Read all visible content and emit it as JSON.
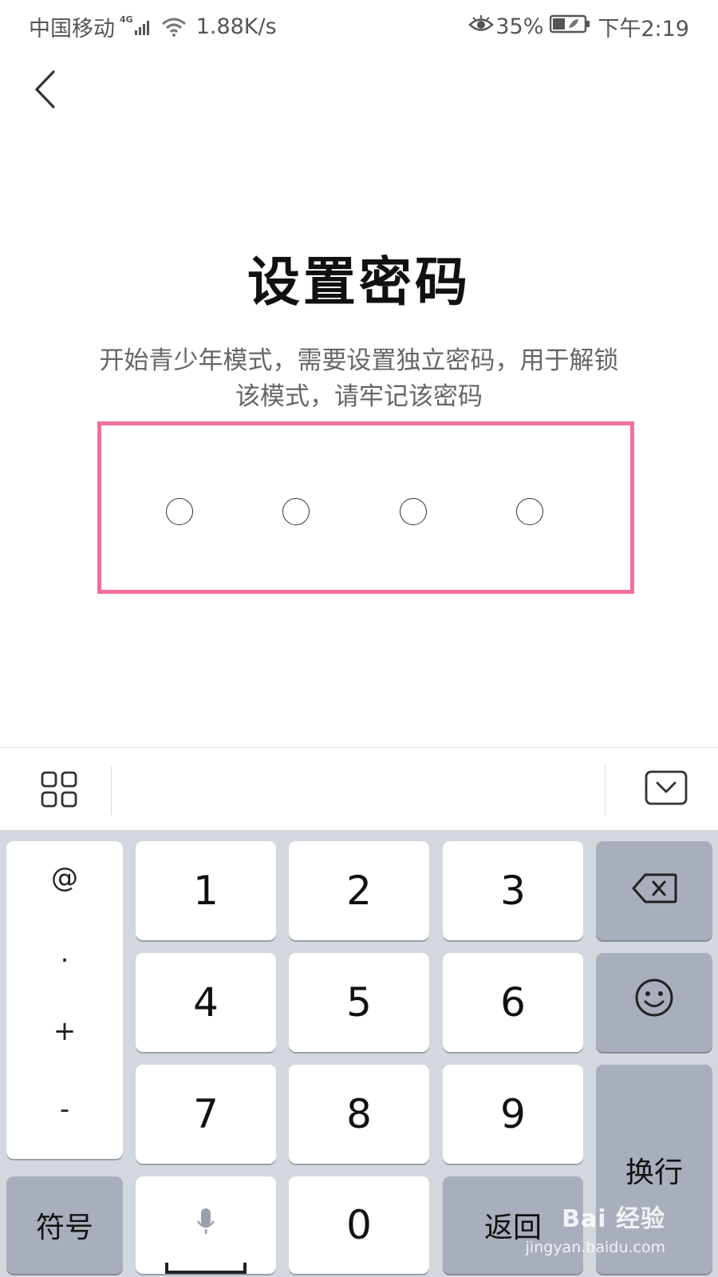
{
  "status_bar": {
    "carrier": "中国移动",
    "network": "4G",
    "speed": "1.88K/s",
    "battery_percent": "35%",
    "time": "下午2:19"
  },
  "page": {
    "title": "设置密码",
    "description_line1": "开始青少年模式，需要设置独立密码，用于解锁",
    "description_line2": "该模式，请牢记该密码"
  },
  "pin": {
    "digits_entered": 0,
    "total": 4,
    "highlight_color": "#f17099"
  },
  "keyboard": {
    "symbols": [
      "@",
      ".",
      "+",
      "-"
    ],
    "keys": [
      "1",
      "2",
      "3",
      "4",
      "5",
      "6",
      "7",
      "8",
      "9",
      "0"
    ],
    "symbol_key": "符号",
    "back_key": "返回",
    "newline_key": "换行"
  },
  "watermark": {
    "brand": "Bai  经验",
    "url": "jingyan.baidu.com"
  },
  "colors": {
    "keyboard_bg": "#d3d7de",
    "gray_key": "#a8aebb"
  }
}
